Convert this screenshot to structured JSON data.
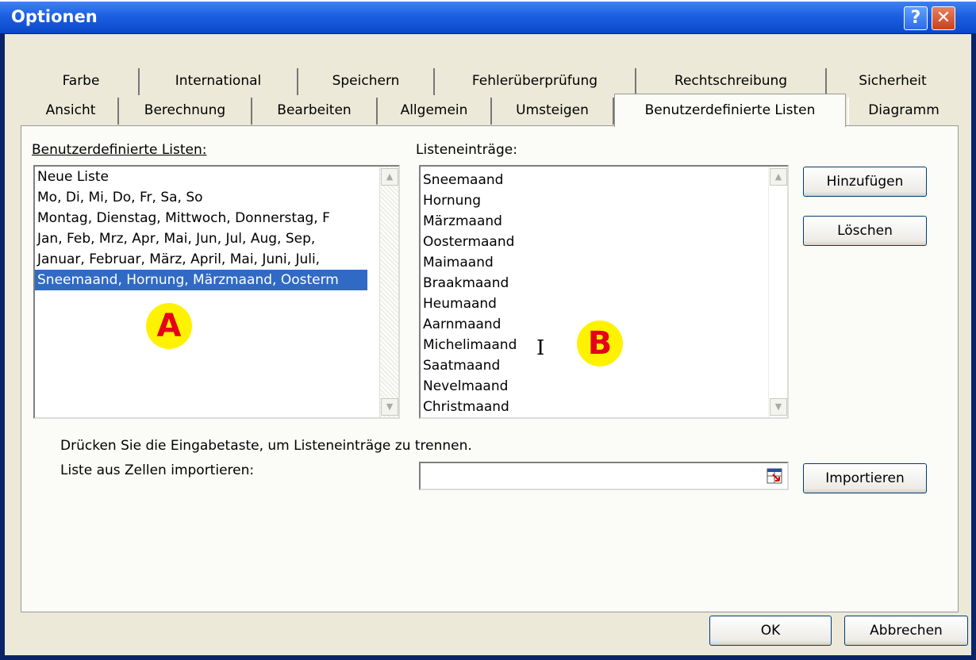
{
  "window": {
    "title": "Optionen",
    "help_label": "?",
    "close_label": "✕"
  },
  "tabs_row1": [
    "Farbe",
    "International",
    "Speichern",
    "Fehlerüberprüfung",
    "Rechtschreibung",
    "Sicherheit"
  ],
  "tabs_row2": [
    "Ansicht",
    "Berechnung",
    "Bearbeiten",
    "Allgemein",
    "Umsteigen",
    "Benutzerdefinierte Listen",
    "Diagramm"
  ],
  "active_tab": "Benutzerdefinierte Listen",
  "custom_lists": {
    "label": "Benutzerdefinierte Listen:",
    "items": [
      "Neue Liste",
      "Mo, Di, Mi, Do, Fr, Sa, So",
      "Montag, Dienstag, Mittwoch, Donnerstag, F",
      "Jan, Feb, Mrz, Apr, Mai, Jun, Jul, Aug, Sep,",
      "Januar, Februar, März, April, Mai, Juni, Juli,",
      "Sneemaand, Hornung, Märzmaand, Oosterm"
    ],
    "selected_index": 5
  },
  "entries": {
    "label": "Listeneinträge:",
    "items": [
      "Sneemaand",
      "Hornung",
      "Märzmaand",
      "Oostermaand",
      "Maimaand",
      "Braakmaand",
      "Heumaand",
      "Aarnmaand",
      "Michelimaand",
      "Saatmaand",
      "Nevelmaand",
      "Christmaand"
    ]
  },
  "buttons": {
    "add": "Hinzufügen",
    "delete": "Löschen",
    "import": "Importieren",
    "ok": "OK",
    "cancel": "Abbrechen"
  },
  "hint": "Drücken Sie die Eingabetaste, um Listeneinträge zu trennen.",
  "import_label": "Liste aus Zellen importieren:",
  "import_value": "",
  "markers": {
    "a": "A",
    "b": "B"
  },
  "colors": {
    "title_bar": "#1d5fe2",
    "selection": "#316ac5",
    "marker_fill": "#fff200",
    "marker_text": "#e4001b"
  }
}
